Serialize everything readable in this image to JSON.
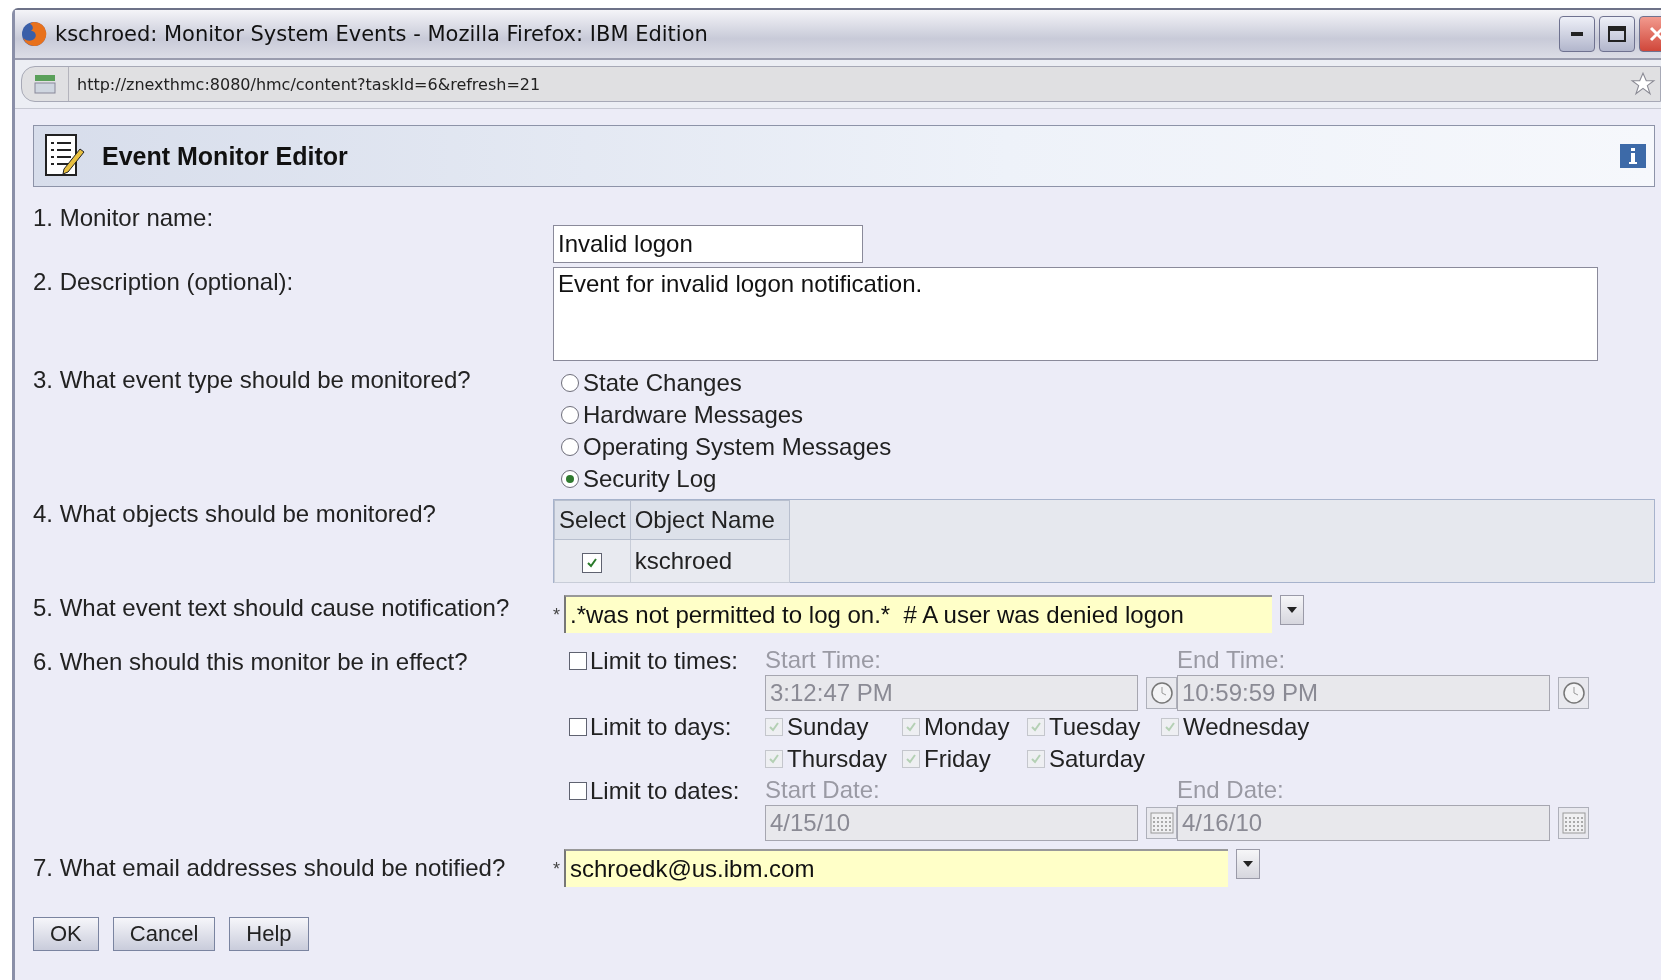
{
  "window": {
    "title": "kschroed: Monitor System Events - Mozilla Firefox: IBM Edition"
  },
  "address_bar": {
    "url": "http://znexthmc:8080/hmc/content?taskId=6&refresh=21"
  },
  "panel": {
    "title": "Event Monitor Editor"
  },
  "monitor_name": {
    "label": "1. Monitor name:",
    "value": "Invalid logon"
  },
  "description": {
    "label": "2. Description (optional):",
    "value": "Event for invalid logon notification."
  },
  "event_type": {
    "label": "3. What event type should be monitored?",
    "options": [
      {
        "label": "State Changes",
        "selected": false
      },
      {
        "label": "Hardware Messages",
        "selected": false
      },
      {
        "label": "Operating System Messages",
        "selected": false
      },
      {
        "label": "Security Log",
        "selected": true
      }
    ]
  },
  "objects": {
    "label": "4. What objects should be monitored?",
    "columns": [
      "Select",
      "Object Name"
    ],
    "rows": [
      {
        "checked": true,
        "name": "kschroed"
      }
    ]
  },
  "event_text": {
    "label": "5. What event text should cause notification?",
    "required_mark": "*",
    "value": ".*was not permitted to log on.*  # A user was denied logon"
  },
  "schedule": {
    "label": "6. When should this monitor be in effect?",
    "times": {
      "label": "Limit to times:",
      "checked": false,
      "start_label": "Start Time:",
      "start_value": "3:12:47 PM",
      "end_label": "End Time:",
      "end_value": "10:59:59 PM"
    },
    "days": {
      "label": "Limit to days:",
      "checked": false,
      "items": [
        {
          "label": "Sunday",
          "checked": true
        },
        {
          "label": "Monday",
          "checked": true
        },
        {
          "label": "Tuesday",
          "checked": true
        },
        {
          "label": "Wednesday",
          "checked": true
        },
        {
          "label": "Thursday",
          "checked": true
        },
        {
          "label": "Friday",
          "checked": true
        },
        {
          "label": "Saturday",
          "checked": true
        }
      ]
    },
    "dates": {
      "label": "Limit to dates:",
      "checked": false,
      "start_label": "Start Date:",
      "start_value": "4/15/10",
      "end_label": "End Date:",
      "end_value": "4/16/10"
    }
  },
  "email": {
    "label": "7. What email addresses should be notified?",
    "required_mark": "*",
    "value": "schroedk@us.ibm.com"
  },
  "buttons": [
    "OK",
    "Cancel",
    "Help"
  ]
}
